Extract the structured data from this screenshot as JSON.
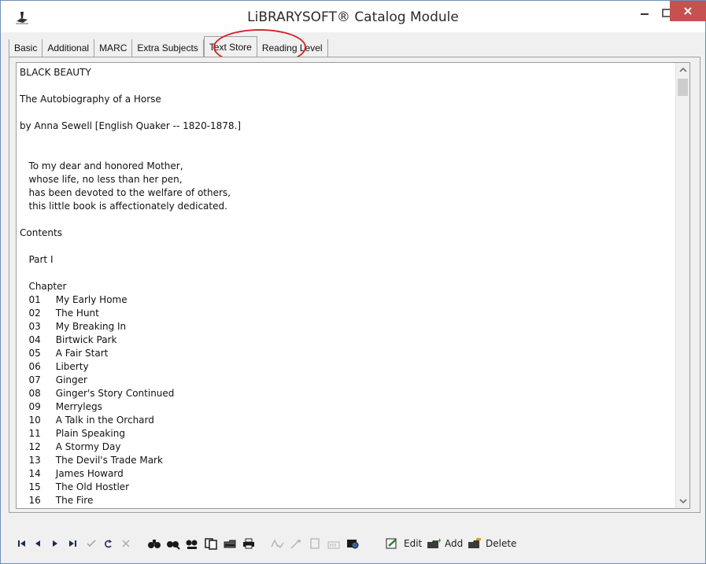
{
  "window": {
    "title": "LiBRARYSOFT® Catalog Module"
  },
  "tabs": [
    {
      "label": "Basic"
    },
    {
      "label": "Additional"
    },
    {
      "label": "MARC"
    },
    {
      "label": "Extra Subjects"
    },
    {
      "label": "Text Store"
    },
    {
      "label": "Reading Level"
    }
  ],
  "active_tab": "Text Store",
  "text_store": {
    "content": "BLACK BEAUTY\n\nThe Autobiography of a Horse\n\nby Anna Sewell [English Quaker -- 1820-1878.]\n\n\n   To my dear and honored Mother,\n   whose life, no less than her pen,\n   has been devoted to the welfare of others,\n   this little book is affectionately dedicated.\n\nContents\n\n   Part I\n\n   Chapter\n   01     My Early Home\n   02     The Hunt\n   03     My Breaking In\n   04     Birtwick Park\n   05     A Fair Start\n   06     Liberty\n   07     Ginger\n   08     Ginger's Story Continued\n   09     Merrylegs\n   10     A Talk in the Orchard\n   11     Plain Speaking\n   12     A Stormy Day\n   13     The Devil's Trade Mark\n   14     James Howard\n   15     The Old Hostler\n   16     The Fire"
  },
  "toolbar": {
    "edit_label": "Edit",
    "add_label": "Add",
    "delete_label": "Delete"
  },
  "colors": {
    "close_button": "#c75050",
    "highlight_circle": "#d8232a"
  }
}
